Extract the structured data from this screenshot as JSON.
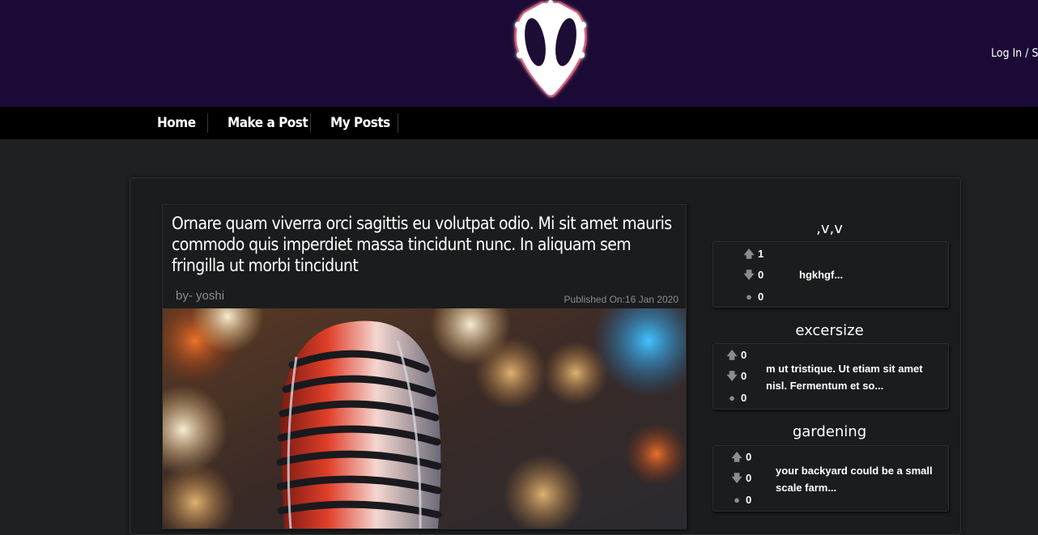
{
  "header": {
    "logo_icon": "alien-head-logo-icon",
    "auth_link": "Log In / Sig"
  },
  "nav": {
    "items": [
      {
        "label": "Home"
      },
      {
        "label": "Make a Post"
      },
      {
        "label": "My Posts"
      }
    ]
  },
  "featured": {
    "title": "Ornare quam viverra orci sagittis eu volutpat odio. Mi sit amet mauris commodo quis imperdiet massa tincidunt nunc. In aliquam sem fringilla ut morbi tincidunt",
    "author": "by- yoshi",
    "published": "Published On:16 Jan 2020",
    "image_icon": "microphone-photo"
  },
  "sidebar": {
    "icons": {
      "upvote": "arrow-up-icon",
      "downvote": "arrow-down-icon",
      "comments": "comment-bubble-icon"
    },
    "posts": [
      {
        "title": ",v,v",
        "upvotes": "1",
        "downvotes": "0",
        "comments": "0",
        "excerpt": "hgkhgf..."
      },
      {
        "title": "excersize",
        "upvotes": "0",
        "downvotes": "0",
        "comments": "0",
        "excerpt": "m ut tristique. Ut etiam sit amet nisl. Fermentum et so..."
      },
      {
        "title": "gardening",
        "upvotes": "0",
        "downvotes": "0",
        "comments": "0",
        "excerpt": "your backyard could be a small scale farm..."
      }
    ]
  }
}
